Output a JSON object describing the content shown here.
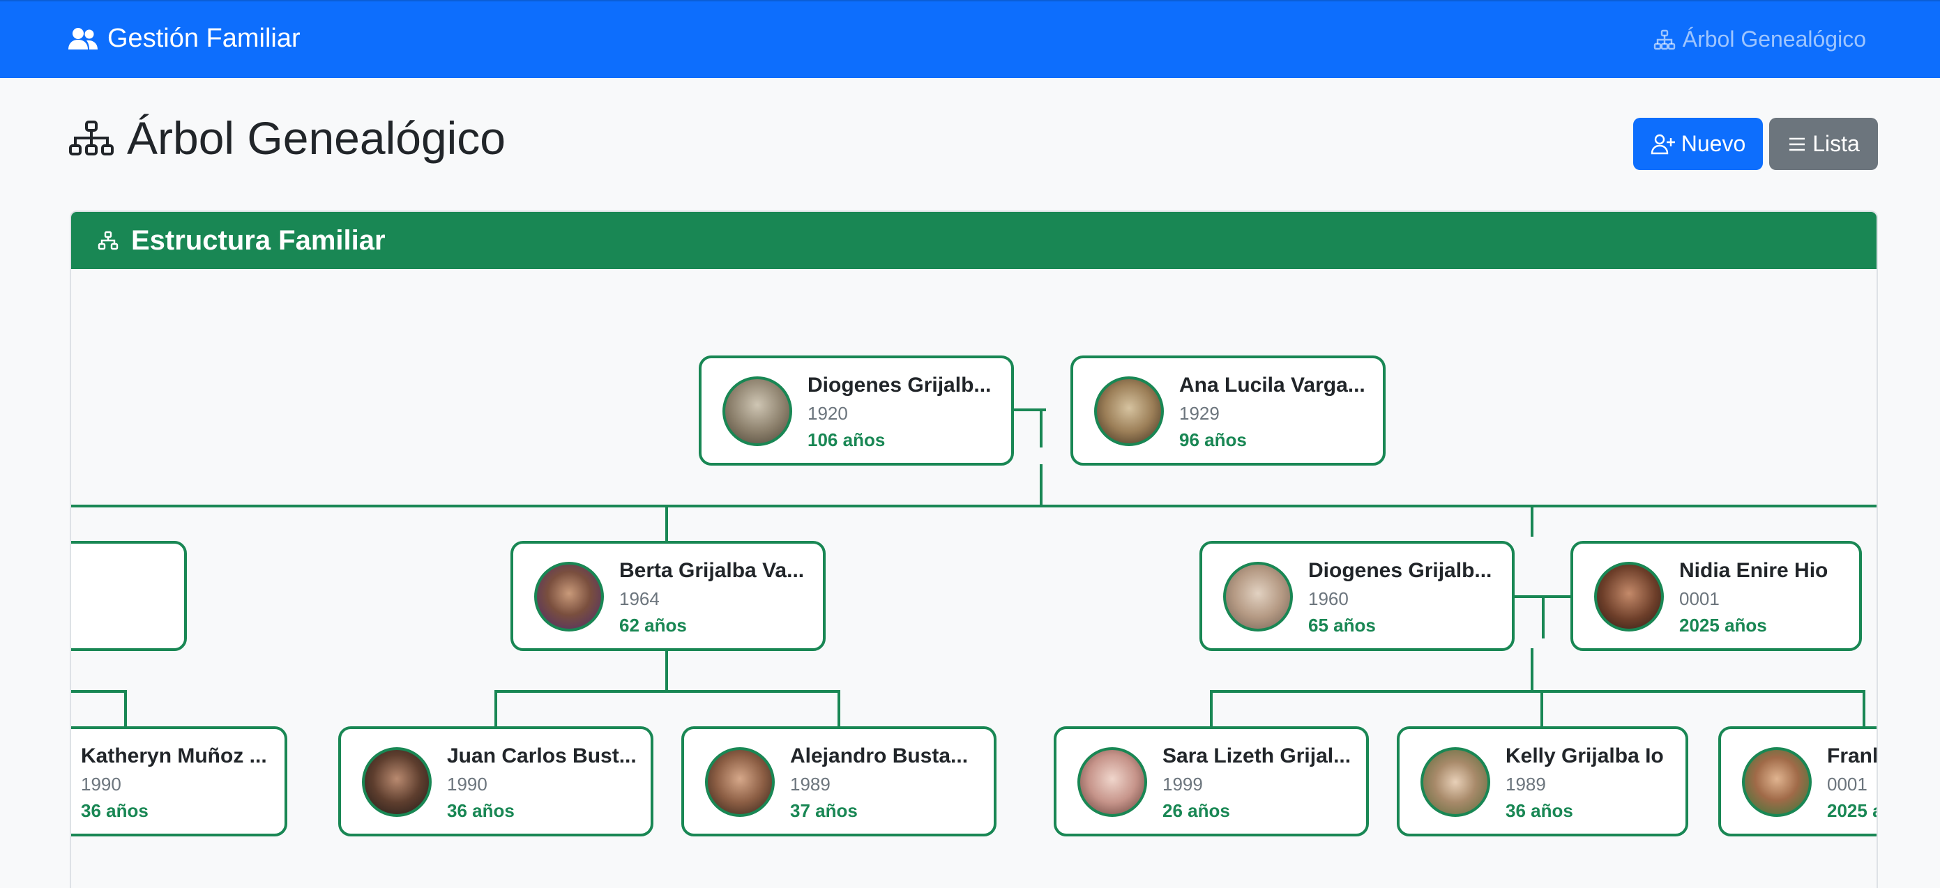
{
  "navbar": {
    "brand": "Gestión Familiar",
    "link": "Árbol Genealógico"
  },
  "page": {
    "title": "Árbol Genealógico"
  },
  "actions": {
    "new_label": "Nuevo",
    "list_label": "Lista"
  },
  "card": {
    "title": "Estructura Familiar"
  },
  "tree": {
    "root": [
      {
        "name": "Diogenes Grijalb...",
        "year": "1920",
        "age": "106 años"
      },
      {
        "name": "Ana Lucila Varga...",
        "year": "1929",
        "age": "96 años"
      }
    ],
    "gen2": [
      {
        "name": "...",
        "year": "",
        "age": ""
      },
      {
        "name": "Berta Grijalba Va...",
        "year": "1964",
        "age": "62 años"
      },
      {
        "name": "Diogenes Grijalb...",
        "year": "1960",
        "age": "65 años"
      },
      {
        "name": "Nidia Enire Hio",
        "year": "0001",
        "age": "2025 años"
      }
    ],
    "gen3": [
      {
        "name": "Katheryn Muñoz ...",
        "year": "1990",
        "age": "36 años"
      },
      {
        "name": "Juan Carlos Bust...",
        "year": "1990",
        "age": "36 años"
      },
      {
        "name": "Alejandro Busta...",
        "year": "1989",
        "age": "37 años"
      },
      {
        "name": "Sara Lizeth Grijal...",
        "year": "1999",
        "age": "26 años"
      },
      {
        "name": "Kelly Grijalba Io",
        "year": "1989",
        "age": "36 años"
      },
      {
        "name": "Frank",
        "year": "0001",
        "age": "2025 a"
      }
    ]
  }
}
